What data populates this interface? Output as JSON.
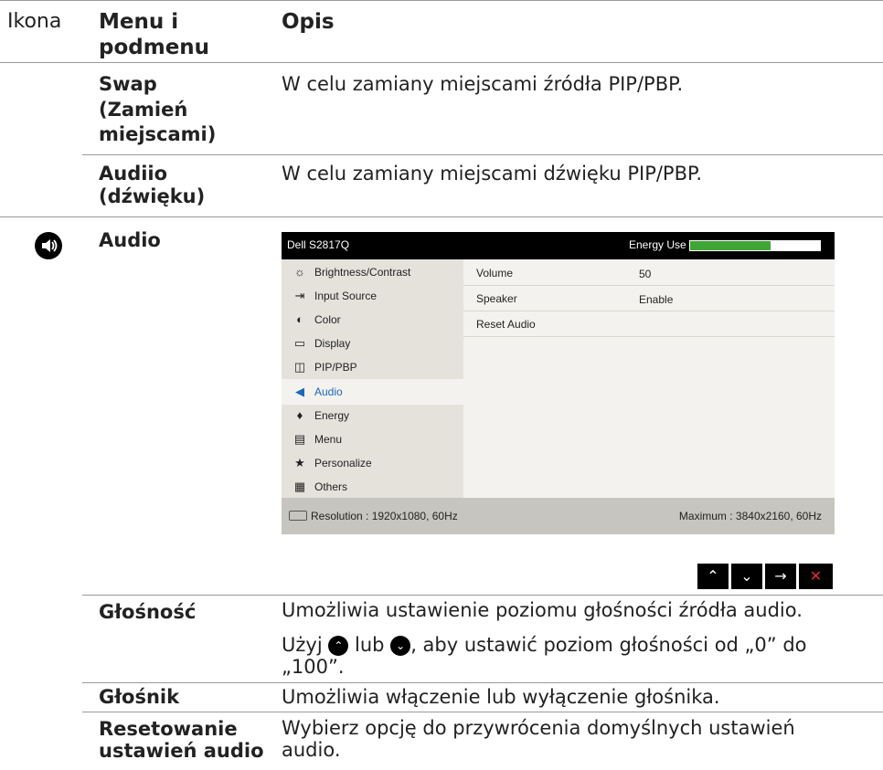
{
  "header": {
    "col_icon": "Ikona",
    "col_menu": "Menu i podmenu",
    "col_desc": "Opis"
  },
  "rows": {
    "swap": {
      "menu": "Swap (Zamień miejscami)",
      "menu_l1": "Swap",
      "menu_l2": "(Zamień",
      "menu_l3": "miejscami)",
      "desc": "W celu zamiany miejscami źródła PIP/PBP."
    },
    "audiio": {
      "menu_l1": "Audiio",
      "menu_l2": "(dźwięku)",
      "desc": "W celu zamiany miejscami dźwięku PIP/PBP."
    },
    "audio": {
      "menu": "Audio",
      "icon": "speaker-icon"
    },
    "glosnosc": {
      "menu": "Głośność",
      "desc_l1": "Umożliwia ustawienie poziomu głośności źródła audio.",
      "desc_pre": "Użyj",
      "desc_mid": "lub",
      "desc_post": ", aby ustawić poziom głośności od „0” do",
      "desc_l3": "„100”."
    },
    "glosnik": {
      "menu": "Głośnik",
      "desc": "Umożliwia włączenie lub wyłączenie głośnika."
    },
    "reset": {
      "menu_l1": "Resetowanie",
      "menu_l2": "ustawień audio",
      "desc_l1": "Wybierz opcję do przywrócenia domyślnych ustawień",
      "desc_l2": "audio."
    }
  },
  "osd": {
    "model": "Dell S2817Q",
    "energy_label": "Energy Use",
    "energy_level": 0.62,
    "menu_items": [
      {
        "label": "Brightness/Contrast",
        "icon": "brightness-icon",
        "glyph": "☼"
      },
      {
        "label": "Input Source",
        "icon": "input-source-icon",
        "glyph": "⇥"
      },
      {
        "label": "Color",
        "icon": "color-icon",
        "glyph": "◐"
      },
      {
        "label": "Display",
        "icon": "display-icon",
        "glyph": "▭"
      },
      {
        "label": "PIP/PBP",
        "icon": "pip-pbp-icon",
        "glyph": "◫"
      },
      {
        "label": "Audio",
        "icon": "audio-icon",
        "glyph": "◀"
      },
      {
        "label": "Energy",
        "icon": "energy-icon",
        "glyph": "♦"
      },
      {
        "label": "Menu",
        "icon": "menu-icon",
        "glyph": "▤"
      },
      {
        "label": "Personalize",
        "icon": "star-icon",
        "glyph": "★"
      },
      {
        "label": "Others",
        "icon": "others-icon",
        "glyph": "▦"
      }
    ],
    "active_index": 5,
    "settings": [
      {
        "key": "Volume",
        "value": "50"
      },
      {
        "key": "Speaker",
        "value": "Enable"
      },
      {
        "key": "Reset Audio",
        "value": ""
      }
    ],
    "resolution": "Resolution : 1920x1080, 60Hz",
    "maximum": "Maximum : 3840x2160, 60Hz"
  },
  "nav_buttons": [
    {
      "name": "up-arrow-button",
      "glyph": "⌃"
    },
    {
      "name": "down-arrow-button",
      "glyph": "⌄"
    },
    {
      "name": "right-arrow-button",
      "glyph": "→"
    },
    {
      "name": "close-button",
      "glyph": "✕"
    }
  ],
  "colors": {
    "energy_green": "#3fa535",
    "active_blue": "#1f66b5",
    "close_red": "#e0312b"
  }
}
